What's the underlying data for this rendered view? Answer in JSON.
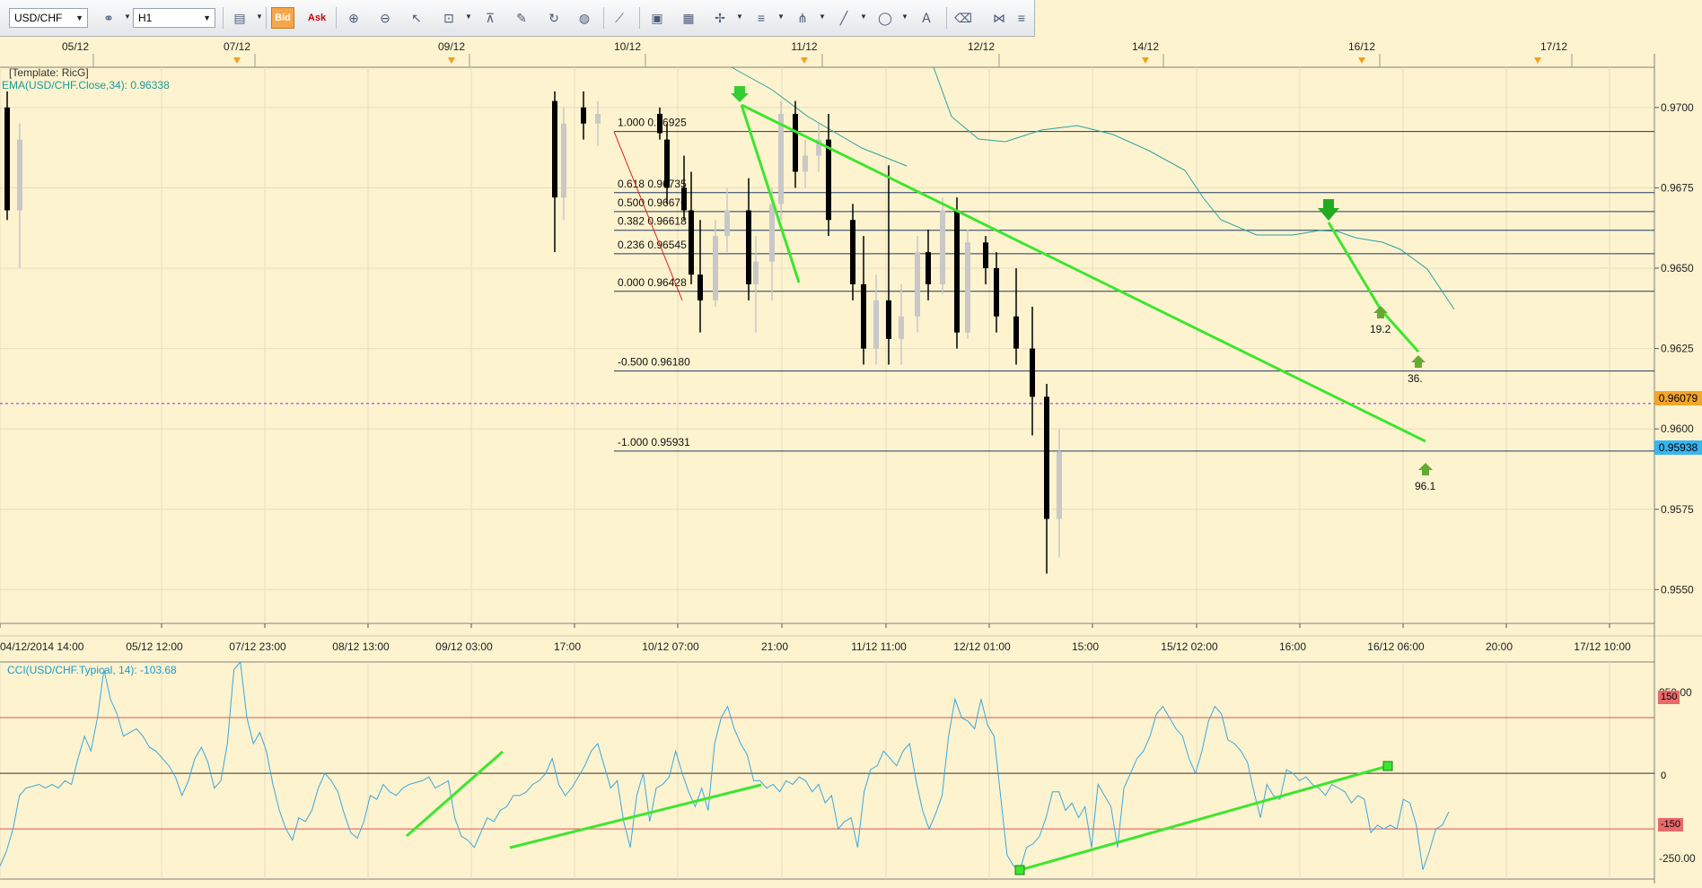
{
  "toolbar": {
    "symbol": "USD/CHF",
    "timeframe": "H1",
    "bid_label": "Bid",
    "ask_label": "Ask",
    "tools": [
      "chart-type-icon",
      "bid-icon",
      "ask-icon",
      "zoom-in-icon",
      "zoom-out-icon",
      "cursor-icon",
      "auto-scale-icon",
      "period-separator-icon",
      "template-icon",
      "refresh-icon",
      "globe-icon",
      "ruler-icon",
      "image-icon",
      "chart-image-icon",
      "crosshair-icon",
      "lines-icon",
      "pitchfork-icon",
      "trend-line-icon",
      "ellipse-icon",
      "text-icon",
      "eraser-icon",
      "objects-icon",
      "more-icon"
    ]
  },
  "main": {
    "template_label": "[Template: RicG]",
    "ema_label": "EMA(USD/CHF.Close,34): 0.96338",
    "top_dates": [
      "05/12",
      "07/12",
      "09/12",
      "10/12",
      "11/12",
      "12/12",
      "14/12",
      "16/12",
      "17/12"
    ],
    "x_ticks": [
      "04/12/2014 14:00",
      "05/12 12:00",
      "07/12 23:00",
      "08/12 13:00",
      "09/12 03:00",
      "17:00",
      "10/12 07:00",
      "21:00",
      "11/12 11:00",
      "12/12 01:00",
      "15:00",
      "15/12 02:00",
      "16:00",
      "16/12 06:00",
      "20:00",
      "17/12 10:00"
    ],
    "y_ticks": [
      "0.9700",
      "0.9675",
      "0.9650",
      "0.9625",
      "0.9600",
      "0.9575",
      "0.9550"
    ],
    "current_price": "0.96079",
    "bid_price": "0.95938",
    "fib_levels": [
      {
        "ratio": "1.000",
        "price": "0.96925"
      },
      {
        "ratio": "0.618",
        "price": "0.96735"
      },
      {
        "ratio": "0.500",
        "price": "0.96676"
      },
      {
        "ratio": "0.382",
        "price": "0.96618"
      },
      {
        "ratio": "0.236",
        "price": "0.96545"
      },
      {
        "ratio": "0.000",
        "price": "0.96428"
      },
      {
        "ratio": "-0.500",
        "price": "0.96180"
      },
      {
        "ratio": "-1.000",
        "price": "0.95931"
      }
    ],
    "markers": [
      "19.2",
      "36.",
      "96.1"
    ]
  },
  "cci": {
    "label": "CCI(USD/CHF.Typical, 14): -103.68",
    "y_ticks": [
      "250.00",
      "150",
      "0",
      "-150",
      "-250.00"
    ]
  },
  "chart_data": [
    {
      "type": "candlestick",
      "symbol": "USD/CHF",
      "timeframe": "H1",
      "ylim": [
        0.954,
        0.9705
      ],
      "y_axis_ticks": [
        0.97,
        0.9675,
        0.965,
        0.9625,
        0.96,
        0.9575,
        0.955
      ],
      "x_axis_ticks": [
        "04/12/2014 14:00",
        "05/12 12:00",
        "07/12 23:00",
        "08/12 13:00",
        "09/12 03:00",
        "17:00",
        "10/12 07:00",
        "21:00",
        "11/12 11:00",
        "12/12 01:00",
        "15:00",
        "15/12 02:00",
        "16:00",
        "16/12 06:00",
        "20:00",
        "17/12 10:00"
      ],
      "grid": true,
      "indicator": {
        "name": "EMA(USD/CHF.Close,34)",
        "last": 0.96338
      },
      "current_price": 0.96079,
      "bid_price": 0.95938,
      "fibonacci": [
        {
          "ratio": 1.0,
          "price": 0.96925
        },
        {
          "ratio": 0.618,
          "price": 0.96735
        },
        {
          "ratio": 0.5,
          "price": 0.96676
        },
        {
          "ratio": 0.382,
          "price": 0.96618
        },
        {
          "ratio": 0.236,
          "price": 0.96545
        },
        {
          "ratio": 0.0,
          "price": 0.96428
        },
        {
          "ratio": -0.5,
          "price": 0.9618
        },
        {
          "ratio": -1.0,
          "price": 0.95931
        }
      ],
      "candles": [
        {
          "t": 0,
          "o": 0.97,
          "h": 0.9705,
          "l": 0.9665,
          "c": 0.9668
        },
        {
          "t": 1,
          "o": 0.9668,
          "h": 0.9695,
          "l": 0.965,
          "c": 0.969
        },
        {
          "t": 40,
          "o": 0.9702,
          "h": 0.9705,
          "l": 0.9655,
          "c": 0.9672
        },
        {
          "t": 41,
          "o": 0.9672,
          "h": 0.97,
          "l": 0.9665,
          "c": 0.9695
        },
        {
          "t": 47,
          "o": 0.97,
          "h": 0.9705,
          "l": 0.969,
          "c": 0.9695
        },
        {
          "t": 49,
          "o": 0.9695,
          "h": 0.9702,
          "l": 0.9688,
          "c": 0.9698
        },
        {
          "t": 53,
          "o": 0.9698,
          "h": 0.97,
          "l": 0.969,
          "c": 0.9692
        },
        {
          "t": 54,
          "o": 0.969,
          "h": 0.9695,
          "l": 0.967,
          "c": 0.9675
        },
        {
          "t": 55,
          "o": 0.9675,
          "h": 0.9685,
          "l": 0.9665,
          "c": 0.9668
        },
        {
          "t": 56,
          "o": 0.9668,
          "h": 0.968,
          "l": 0.9645,
          "c": 0.9648
        },
        {
          "t": 57,
          "o": 0.9648,
          "h": 0.9665,
          "l": 0.963,
          "c": 0.964
        },
        {
          "t": 58,
          "o": 0.964,
          "h": 0.9665,
          "l": 0.9638,
          "c": 0.966
        },
        {
          "t": 59,
          "o": 0.966,
          "h": 0.9675,
          "l": 0.9655,
          "c": 0.9668
        },
        {
          "t": 60,
          "o": 0.9668,
          "h": 0.9678,
          "l": 0.964,
          "c": 0.9645
        },
        {
          "t": 61,
          "o": 0.9645,
          "h": 0.966,
          "l": 0.963,
          "c": 0.9652
        },
        {
          "t": 62,
          "o": 0.9652,
          "h": 0.9675,
          "l": 0.964,
          "c": 0.967
        },
        {
          "t": 63,
          "o": 0.967,
          "h": 0.9702,
          "l": 0.9665,
          "c": 0.9698
        },
        {
          "t": 64,
          "o": 0.9698,
          "h": 0.9702,
          "l": 0.9675,
          "c": 0.968
        },
        {
          "t": 65,
          "o": 0.968,
          "h": 0.969,
          "l": 0.9675,
          "c": 0.9685
        },
        {
          "t": 66,
          "o": 0.9685,
          "h": 0.9695,
          "l": 0.968,
          "c": 0.969
        },
        {
          "t": 67,
          "o": 0.969,
          "h": 0.9698,
          "l": 0.966,
          "c": 0.9665
        },
        {
          "t": 68,
          "o": 0.9665,
          "h": 0.967,
          "l": 0.964,
          "c": 0.9645
        },
        {
          "t": 69,
          "o": 0.9645,
          "h": 0.966,
          "l": 0.962,
          "c": 0.9625
        },
        {
          "t": 70,
          "o": 0.9625,
          "h": 0.9648,
          "l": 0.962,
          "c": 0.964
        },
        {
          "t": 71,
          "o": 0.964,
          "h": 0.9682,
          "l": 0.962,
          "c": 0.9628
        },
        {
          "t": 72,
          "o": 0.9628,
          "h": 0.9645,
          "l": 0.962,
          "c": 0.9635
        },
        {
          "t": 73,
          "o": 0.9635,
          "h": 0.966,
          "l": 0.963,
          "c": 0.9655
        },
        {
          "t": 74,
          "o": 0.9655,
          "h": 0.9662,
          "l": 0.964,
          "c": 0.9645
        },
        {
          "t": 75,
          "o": 0.9645,
          "h": 0.9672,
          "l": 0.9642,
          "c": 0.9668
        },
        {
          "t": 76,
          "o": 0.9668,
          "h": 0.9672,
          "l": 0.9625,
          "c": 0.963
        },
        {
          "t": 77,
          "o": 0.963,
          "h": 0.9662,
          "l": 0.9628,
          "c": 0.9658
        },
        {
          "t": 78,
          "o": 0.9658,
          "h": 0.966,
          "l": 0.9645,
          "c": 0.965
        },
        {
          "t": 79,
          "o": 0.965,
          "h": 0.9655,
          "l": 0.963,
          "c": 0.9635
        },
        {
          "t": 80,
          "o": 0.9635,
          "h": 0.965,
          "l": 0.962,
          "c": 0.9625
        },
        {
          "t": 81,
          "o": 0.9625,
          "h": 0.9638,
          "l": 0.9598,
          "c": 0.961
        },
        {
          "t": 82,
          "o": 0.961,
          "h": 0.9614,
          "l": 0.9555,
          "c": 0.9572
        },
        {
          "t": 83,
          "o": 0.9572,
          "h": 0.96,
          "l": 0.956,
          "c": 0.9593
        }
      ]
    },
    {
      "type": "line",
      "name": "CCI(USD/CHF.Typical, 14)",
      "last": -103.68,
      "ylim": [
        -290,
        300
      ],
      "y_axis_ticks": [
        250,
        150,
        0,
        -150,
        -250
      ],
      "reference_lines": [
        150,
        0,
        -150
      ],
      "values": [
        -250,
        -210,
        -150,
        -60,
        -40,
        -35,
        -30,
        -40,
        -30,
        -40,
        -20,
        -30,
        40,
        100,
        60,
        150,
        280,
        200,
        160,
        100,
        110,
        120,
        100,
        70,
        60,
        40,
        20,
        -10,
        -60,
        -20,
        40,
        70,
        30,
        -40,
        -20,
        80,
        280,
        300,
        150,
        80,
        110,
        60,
        -30,
        -100,
        -150,
        -180,
        -120,
        -130,
        -100,
        -40,
        0,
        -20,
        -50,
        -110,
        -160,
        -175,
        -130,
        -60,
        -70,
        -30,
        -50,
        -60,
        -40,
        -30,
        -25,
        -20,
        -10,
        -40,
        -30,
        -20,
        -120,
        -170,
        -180,
        -200,
        -160,
        -120,
        -130,
        -100,
        -90,
        -60,
        -60,
        -50,
        -30,
        -20,
        0,
        40,
        -30,
        -60,
        -40,
        -10,
        20,
        60,
        80,
        20,
        -40,
        -20,
        -130,
        -200,
        -60,
        0,
        -130,
        -40,
        -30,
        -10,
        60,
        0,
        -50,
        -90,
        -40,
        -100,
        80,
        150,
        180,
        120,
        80,
        50,
        -20,
        -20,
        -40,
        -30,
        -50,
        -20,
        -30,
        -10,
        -20,
        -50,
        -30,
        -80,
        -60,
        -150,
        -130,
        -120,
        -200,
        -50,
        10,
        20,
        60,
        40,
        20,
        60,
        80,
        -20,
        -100,
        -150,
        -110,
        -60,
        100,
        200,
        150,
        140,
        120,
        200,
        130,
        100,
        -60,
        -220,
        -250,
        -260,
        -200,
        -190,
        -170,
        -120,
        -50,
        -50,
        -100,
        -80,
        -120,
        -90,
        -200,
        -30,
        -60,
        -90,
        -200,
        -40,
        0,
        40,
        60,
        100,
        160,
        180,
        150,
        120,
        100,
        40,
        0,
        60,
        140,
        180,
        160,
        90,
        80,
        60,
        30,
        -50,
        -120,
        -30,
        -60,
        -70,
        10,
        0,
        -20,
        -10,
        -30,
        -40,
        -60,
        -30,
        -40,
        -50,
        -80,
        -60,
        -70,
        -160,
        -140,
        -150,
        -140,
        -150,
        -70,
        -80,
        -140,
        -260,
        -210,
        -150,
        -140,
        -103.68
      ]
    }
  ]
}
